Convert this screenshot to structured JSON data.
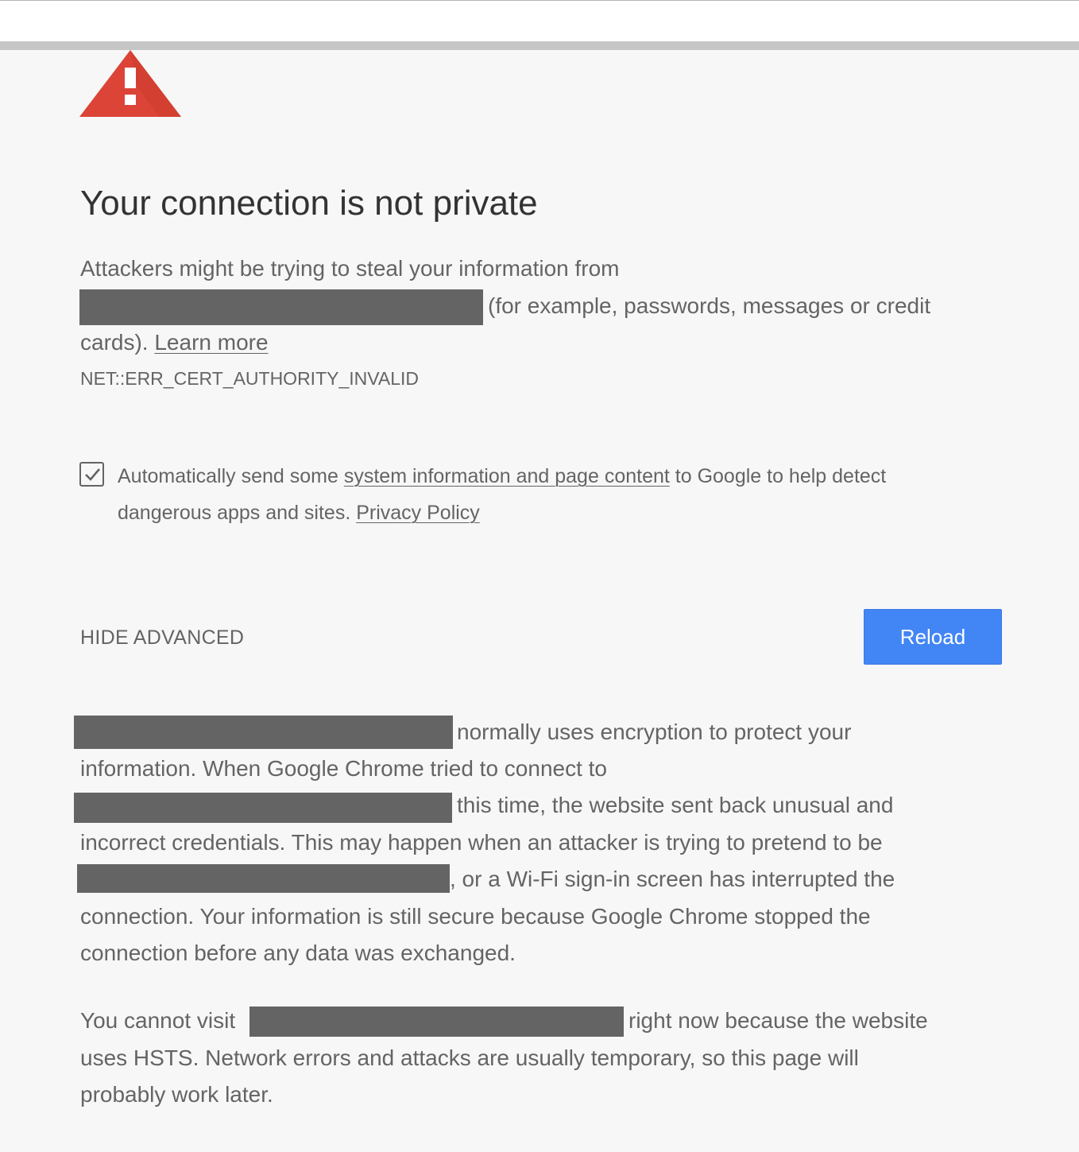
{
  "title": "Your connection is not private",
  "intro": {
    "line1": "Attackers might be trying to steal your information from",
    "line2_after_redaction": "(for example, passwords, messages or credit",
    "line3_before_link": "cards). ",
    "learn_more": "Learn more"
  },
  "error_code": "NET::ERR_CERT_AUTHORITY_INVALID",
  "opt_in": {
    "checked": true,
    "text_before_link": "Automatically send some ",
    "link": "system information and page content",
    "text_after_link": " to Google to help detect",
    "line2_before_link": "dangerous apps and sites. ",
    "privacy_policy": "Privacy Policy"
  },
  "hide_advanced": "HIDE ADVANCED",
  "reload_button": "Reload",
  "details": {
    "line1": "normally uses encryption to protect your",
    "line2": "information. When Google Chrome tried to connect to",
    "line3": "this time, the website sent back unusual and",
    "line4": "incorrect credentials. This may happen when an attacker is trying to pretend to be",
    "line5": ", or a Wi-Fi sign-in screen has interrupted the",
    "line6": "connection. Your information is still secure because Google Chrome stopped the",
    "line7": "connection before any data was exchanged."
  },
  "hsts": {
    "line1_before": "You cannot visit",
    "line1_after": "right now because the website",
    "line2": "uses HSTS. Network errors and attacks are usually temporary, so this page will",
    "line3": "probably work later."
  },
  "colors": {
    "background": "#f7f7f7",
    "warning_red": "#db4437",
    "button_blue": "#4285f4",
    "text": "#646464",
    "heading": "#333333",
    "redaction": "#646464"
  }
}
